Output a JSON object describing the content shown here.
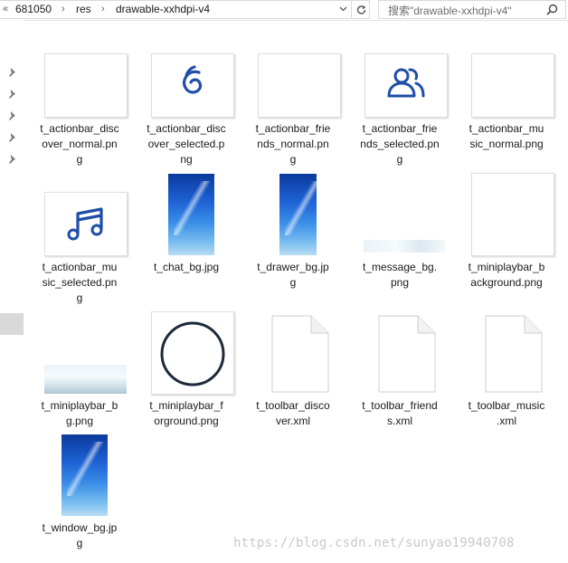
{
  "address_bar": {
    "breadcrumbs": [
      "681050",
      "res",
      "drawable-xxhdpi-v4"
    ],
    "search_placeholder": "搜索\"drawable-xxhdpi-v4\""
  },
  "files": [
    {
      "name": "t_actionbar_discover_normal.png",
      "label_lines": [
        "t_actionbar_disc",
        "over_normal.pn",
        "g"
      ],
      "thumb": "blank"
    },
    {
      "name": "t_actionbar_discover_selected.png",
      "label_lines": [
        "t_actionbar_disc",
        "over_selected.p",
        "ng"
      ],
      "thumb": "discover-icon"
    },
    {
      "name": "t_actionbar_friends_normal.png",
      "label_lines": [
        "t_actionbar_frie",
        "nds_normal.pn",
        "g"
      ],
      "thumb": "blank"
    },
    {
      "name": "t_actionbar_friends_selected.png",
      "label_lines": [
        "t_actionbar_frie",
        "nds_selected.pn",
        "g"
      ],
      "thumb": "friends-icon"
    },
    {
      "name": "t_actionbar_music_normal.png",
      "label_lines": [
        "t_actionbar_mu",
        "sic_normal.png"
      ],
      "thumb": "blank"
    },
    {
      "name": "t_actionbar_music_selected.png",
      "label_lines": [
        "t_actionbar_mu",
        "sic_selected.pn",
        "g"
      ],
      "thumb": "music-icon"
    },
    {
      "name": "t_chat_bg.jpg",
      "label_lines": [
        "t_chat_bg.jpg"
      ],
      "thumb": "photo"
    },
    {
      "name": "t_drawer_bg.jpg",
      "label_lines": [
        "t_drawer_bg.jp",
        "g"
      ],
      "thumb": "photo"
    },
    {
      "name": "t_message_bg.png",
      "label_lines": [
        "t_message_bg.",
        "png"
      ],
      "thumb": "strip"
    },
    {
      "name": "t_miniplaybar_background.png",
      "label_lines": [
        "t_miniplaybar_b",
        "ackground.png"
      ],
      "thumb": "blank"
    },
    {
      "name": "t_miniplaybar_bg.png",
      "label_lines": [
        "t_miniplaybar_b",
        "g.png"
      ],
      "thumb": "strip"
    },
    {
      "name": "t_miniplaybar_forground.png",
      "label_lines": [
        "t_miniplaybar_f",
        "orground.png"
      ],
      "thumb": "ring"
    },
    {
      "name": "t_toolbar_discover.xml",
      "label_lines": [
        "t_toolbar_disco",
        "ver.xml"
      ],
      "thumb": "document-icon"
    },
    {
      "name": "t_toolbar_friends.xml",
      "label_lines": [
        "t_toolbar_friend",
        "s.xml"
      ],
      "thumb": "document-icon"
    },
    {
      "name": "t_toolbar_music.xml",
      "label_lines": [
        "t_toolbar_music",
        ".xml"
      ],
      "thumb": "document-icon"
    },
    {
      "name": "t_window_bg.jpg",
      "label_lines": [
        "t_window_bg.jp",
        "g"
      ],
      "thumb": "photo"
    }
  ],
  "watermark": "https://blog.csdn.net/sunyao19940708",
  "colors": {
    "icon_blue": "#1f4ea8",
    "ring": "#1c2a3a",
    "selection_gray": "#d9d9d9"
  }
}
